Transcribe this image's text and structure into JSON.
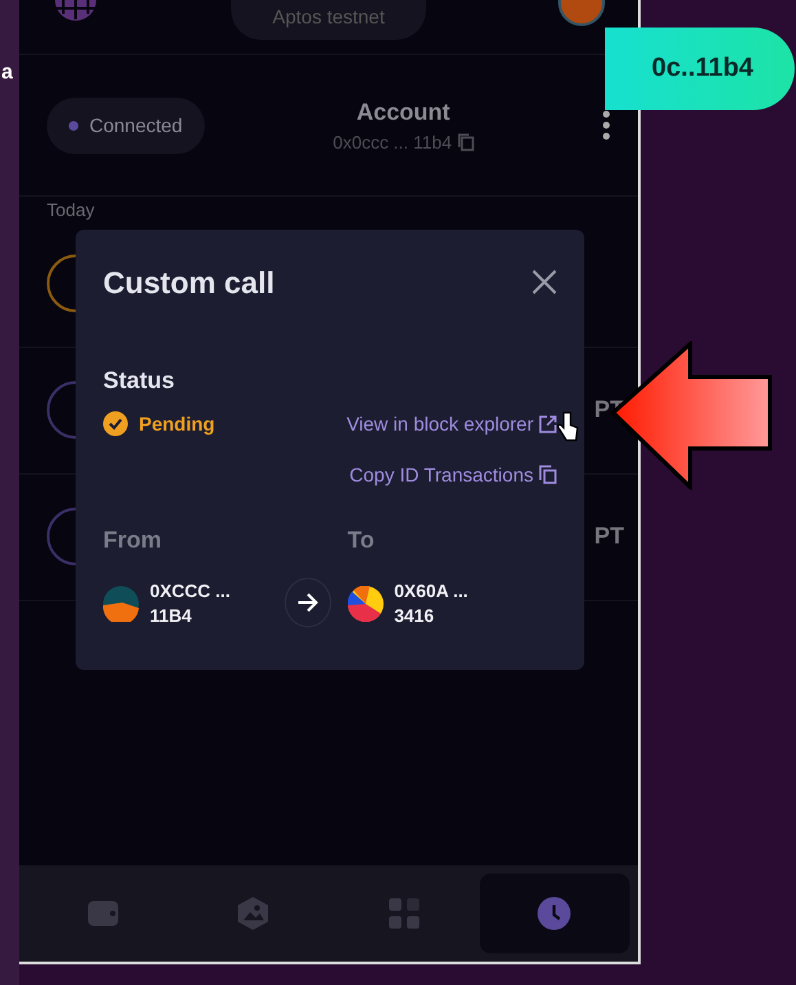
{
  "edge_text": "a",
  "header": {
    "network": "Aptos testnet"
  },
  "connect_button": {
    "label": "0c..11b4"
  },
  "account": {
    "status": "Connected",
    "title": "Account",
    "address": "0x0ccc ... 11b4"
  },
  "activity": {
    "section": "Today",
    "rows": [
      {
        "kind": "pending",
        "amount": ""
      },
      {
        "kind": "done",
        "amount": "PT"
      },
      {
        "kind": "done",
        "amount": "PT"
      }
    ]
  },
  "dialog": {
    "title": "Custom call",
    "status_heading": "Status",
    "status": "Pending",
    "explorer_link": "View in block explorer",
    "copy_link": "Copy ID Transactions",
    "from": {
      "heading": "From",
      "line_1": "0XCCC ...",
      "line_2": "11B4"
    },
    "to": {
      "heading": "To",
      "line_1": "0X60A ...",
      "line_2": "3416"
    }
  },
  "nav": [
    {
      "kind": "wallet",
      "selected": false
    },
    {
      "kind": "gallery",
      "selected": false
    },
    {
      "kind": "apps",
      "selected": false
    },
    {
      "kind": "history",
      "selected": true
    }
  ]
}
